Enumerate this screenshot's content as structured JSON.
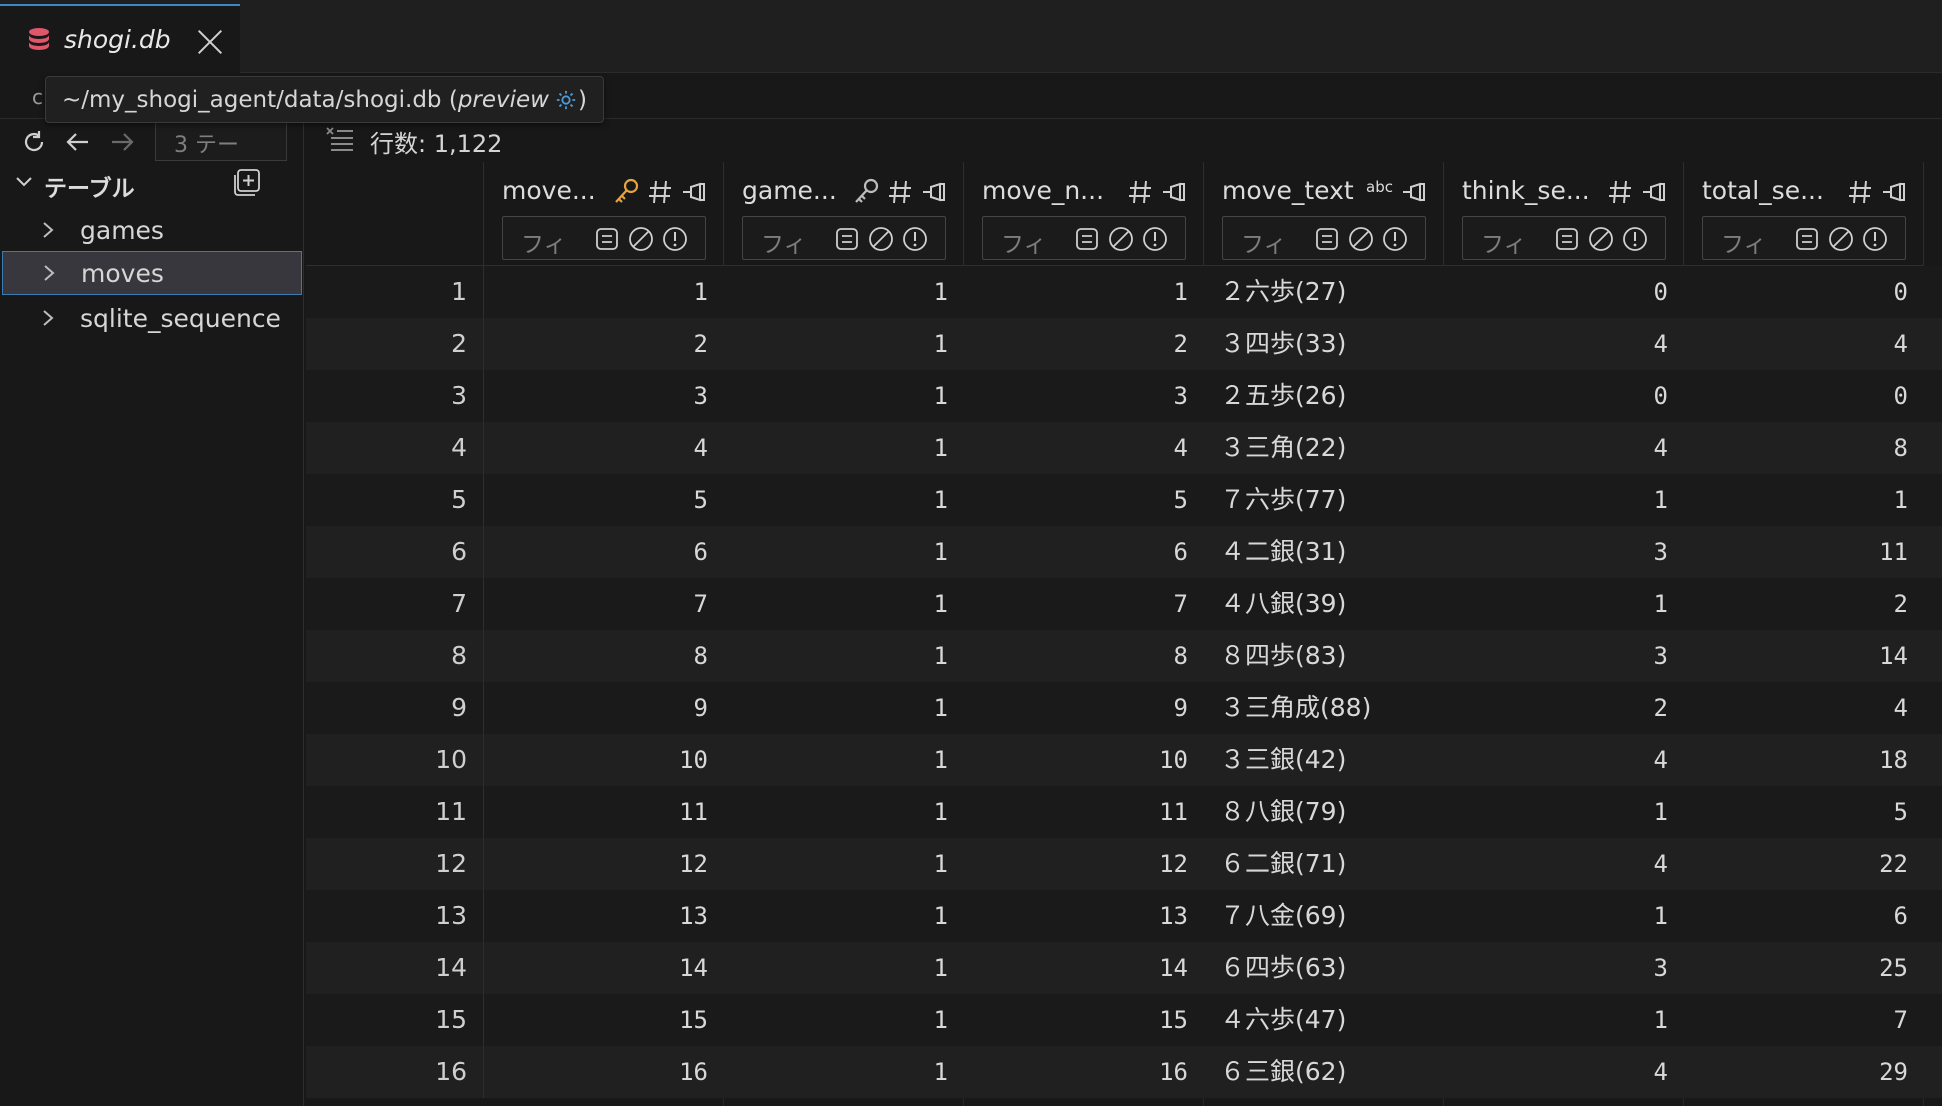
{
  "tab": {
    "title": "shogi.db"
  },
  "breadcrumb": {
    "stub": "c"
  },
  "tooltip": {
    "path": "~/my_shogi_agent/data/shogi.db (",
    "mode": "preview",
    "suffix": ")"
  },
  "toolbar": {
    "table_box": "3 テー",
    "row_count_label": "行数: 1,122"
  },
  "sidebar": {
    "heading": "テーブル",
    "items": [
      {
        "label": "games"
      },
      {
        "label": "moves"
      },
      {
        "label": "sqlite_sequence"
      }
    ]
  },
  "columns": [
    {
      "name": "move...",
      "key": true,
      "key_color": "#e8a33d",
      "type": "#",
      "filter_placeholder": "フィ"
    },
    {
      "name": "game...",
      "key": true,
      "key_color": "#bcbcbc",
      "type": "#",
      "filter_placeholder": "フィ"
    },
    {
      "name": "move_n...",
      "key": false,
      "type": "#",
      "filter_placeholder": "フィ"
    },
    {
      "name": "move_text",
      "key": false,
      "type": "abc",
      "filter_placeholder": "フィ"
    },
    {
      "name": "think_se...",
      "key": false,
      "type": "#",
      "filter_placeholder": "フィ"
    },
    {
      "name": "total_se...",
      "key": false,
      "type": "#",
      "filter_placeholder": "フィ"
    }
  ],
  "rows": [
    {
      "n": "1",
      "c": [
        "1",
        "1",
        "1",
        "２六歩(27)",
        "0",
        "0"
      ]
    },
    {
      "n": "2",
      "c": [
        "2",
        "1",
        "2",
        "３四歩(33)",
        "4",
        "4"
      ]
    },
    {
      "n": "3",
      "c": [
        "3",
        "1",
        "3",
        "２五歩(26)",
        "0",
        "0"
      ]
    },
    {
      "n": "4",
      "c": [
        "4",
        "1",
        "4",
        "３三角(22)",
        "4",
        "8"
      ]
    },
    {
      "n": "5",
      "c": [
        "5",
        "1",
        "5",
        "７六歩(77)",
        "1",
        "1"
      ]
    },
    {
      "n": "6",
      "c": [
        "6",
        "1",
        "6",
        "４二銀(31)",
        "3",
        "11"
      ]
    },
    {
      "n": "7",
      "c": [
        "7",
        "1",
        "7",
        "４八銀(39)",
        "1",
        "2"
      ]
    },
    {
      "n": "8",
      "c": [
        "8",
        "1",
        "8",
        "８四歩(83)",
        "3",
        "14"
      ]
    },
    {
      "n": "9",
      "c": [
        "9",
        "1",
        "9",
        "３三角成(88)",
        "2",
        "4"
      ]
    },
    {
      "n": "10",
      "c": [
        "10",
        "1",
        "10",
        "３三銀(42)",
        "4",
        "18"
      ]
    },
    {
      "n": "11",
      "c": [
        "11",
        "1",
        "11",
        "８八銀(79)",
        "1",
        "5"
      ]
    },
    {
      "n": "12",
      "c": [
        "12",
        "1",
        "12",
        "６二銀(71)",
        "4",
        "22"
      ]
    },
    {
      "n": "13",
      "c": [
        "13",
        "1",
        "13",
        "７八金(69)",
        "1",
        "6"
      ]
    },
    {
      "n": "14",
      "c": [
        "14",
        "1",
        "14",
        "６四歩(63)",
        "3",
        "25"
      ]
    },
    {
      "n": "15",
      "c": [
        "15",
        "1",
        "15",
        "４六歩(47)",
        "1",
        "7"
      ]
    },
    {
      "n": "16",
      "c": [
        "16",
        "1",
        "16",
        "６三銀(62)",
        "4",
        "29"
      ]
    }
  ],
  "colors": {
    "accent": "#3b7bb4",
    "db_icon": "#e0566b",
    "key_primary": "#e8a33d",
    "gear": "#4e9ad6"
  }
}
